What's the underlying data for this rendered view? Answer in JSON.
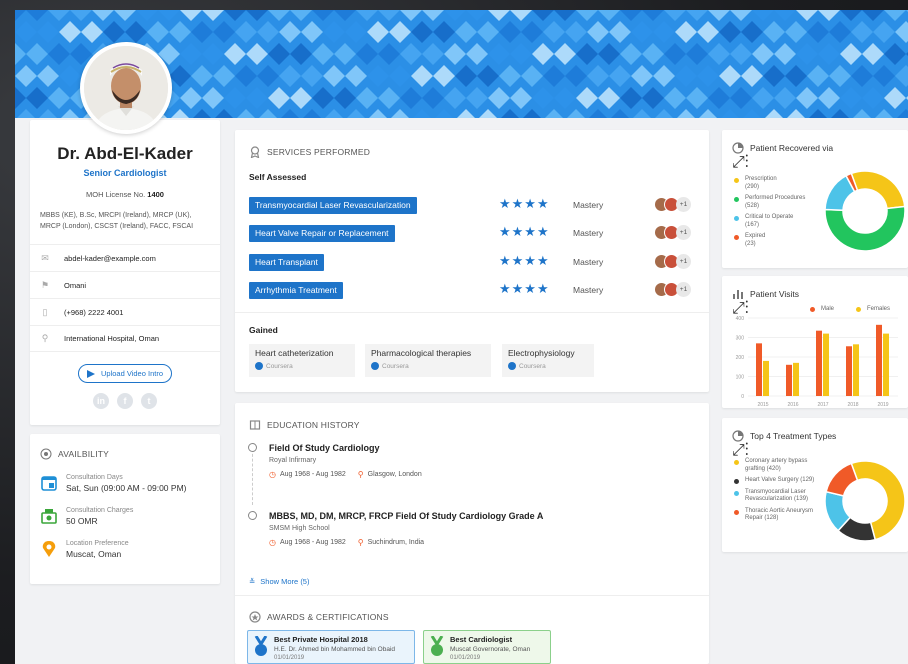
{
  "profile": {
    "name": "Dr. Abd-El-Kader",
    "title": "Senior Cardiologist",
    "license_label": "MOH License No.",
    "license_no": "1400",
    "qualifications": "MBBS (KE), B.Sc, MRCPI (Ireland), MRCP (UK), MRCP (London), CSCST (Ireland), FACC, FSCAI",
    "email": "abdel-kader@example.com",
    "nationality": "Omani",
    "phone": "(+968) 2222 4001",
    "hospital": "International Hospital, Oman",
    "upload_label": "Upload Video Intro",
    "social": [
      "in",
      "f",
      "t"
    ]
  },
  "availability": {
    "header": "AVAILBILITY",
    "items": [
      {
        "label": "Consultation Days",
        "value": "Sat, Sun (09:00 AM - 09:00 PM)",
        "icon": "calendar-icon"
      },
      {
        "label": "Consultation Charges",
        "value": "50 OMR",
        "icon": "money-icon"
      },
      {
        "label": "Location Preference",
        "value": "Muscat, Oman",
        "icon": "location-pin-icon"
      }
    ]
  },
  "services": {
    "header": "SERVICES PERFORMED",
    "self_assessed_label": "Self Assessed",
    "items": [
      {
        "name": "Transmyocardial Laser Revascularization",
        "stars": 4,
        "level": "Mastery",
        "extra": "+1"
      },
      {
        "name": "Heart Valve Repair or Replacement",
        "stars": 4,
        "level": "Mastery",
        "extra": "+1"
      },
      {
        "name": "Heart Transplant",
        "stars": 4,
        "level": "Mastery",
        "extra": "+1"
      },
      {
        "name": "Arrhythmia Treatment",
        "stars": 4,
        "level": "Mastery",
        "extra": "+1"
      }
    ],
    "stars_text": "★★★★",
    "gained_label": "Gained",
    "gained": [
      {
        "name": "Heart catheterization",
        "source": "Coursera"
      },
      {
        "name": "Pharmacological therapies",
        "source": "Coursera"
      },
      {
        "name": "Electrophysiology",
        "source": "Coursera"
      }
    ]
  },
  "education": {
    "header": "EDUCATION HISTORY",
    "items": [
      {
        "title": "Field Of Study Cardiology",
        "school": "Royal Infirmary",
        "dates": "Aug 1968 - Aug 1982",
        "place": "Glasgow, London"
      },
      {
        "title": "MBBS, MD, DM, MRCP, FRCP Field Of Study Cardiology Grade A",
        "school": "SMSM High School",
        "dates": "Aug 1968 - Aug 1982",
        "place": "Suchindrum, India"
      }
    ],
    "show_more": "Show More (5)"
  },
  "awards": {
    "header": "AWARDS & CERTIFICATIONS",
    "items": [
      {
        "title": "Best Private Hospital 2018",
        "by": "H.E. Dr. Ahmed bin Mohammed bin Obaid",
        "date": "01/01/2019",
        "color": "#1e74c9"
      },
      {
        "title": "Best Cardiologist",
        "by": "Muscat Governorate, Oman",
        "date": "01/01/2019",
        "color": "#4caf50"
      }
    ]
  },
  "recovered": {
    "title": "Patient Recovered via",
    "legend": [
      {
        "label": "Prescription",
        "value": "(290)",
        "color": "#f5c518"
      },
      {
        "label": "Performed Procedures",
        "value": "(528)",
        "color": "#22c55e"
      },
      {
        "label": "Critical to Operate",
        "value": "(167)",
        "color": "#4dc3e8"
      },
      {
        "label": "Expired",
        "value": "(23)",
        "color": "#f05a28"
      }
    ]
  },
  "visits": {
    "title": "Patient Visits",
    "legend_male": "Male",
    "legend_female": "Females"
  },
  "treatments": {
    "title": "Top 4 Treatment Types",
    "legend": [
      {
        "label": "Coronary artery bypass grafting (420)",
        "color": "#f5c518"
      },
      {
        "label": "Heart Valve Surgery (129)",
        "color": "#333333"
      },
      {
        "label": "Transmyocardial Laser Revascularization (139)",
        "color": "#4dc3e8"
      },
      {
        "label": "Thoracic Aortic Aneurysm Repair (128)",
        "color": "#f05a28"
      }
    ]
  },
  "chart_data": [
    {
      "type": "pie",
      "title": "Patient Recovered via",
      "categories": [
        "Prescription",
        "Performed Procedures",
        "Critical to Operate",
        "Expired"
      ],
      "values": [
        290,
        528,
        167,
        23
      ]
    },
    {
      "type": "bar",
      "title": "Patient Visits",
      "categories": [
        "2015",
        "2016",
        "2017",
        "2018",
        "2019"
      ],
      "series": [
        {
          "name": "Male",
          "values": [
            270,
            160,
            335,
            255,
            365
          ]
        },
        {
          "name": "Females",
          "values": [
            180,
            170,
            320,
            265,
            320
          ]
        }
      ],
      "y_ticks": [
        "400",
        "300",
        "200",
        "100",
        "0"
      ],
      "ylim": [
        0,
        400
      ],
      "colors": [
        "#f05a28",
        "#f5c518"
      ]
    },
    {
      "type": "pie",
      "title": "Top 4 Treatment Types",
      "categories": [
        "Coronary artery bypass grafting",
        "Heart Valve Surgery",
        "Transmyocardial Laser Revascularization",
        "Thoracic Aortic Aneurysm Repair"
      ],
      "values": [
        420,
        129,
        139,
        128
      ]
    }
  ]
}
